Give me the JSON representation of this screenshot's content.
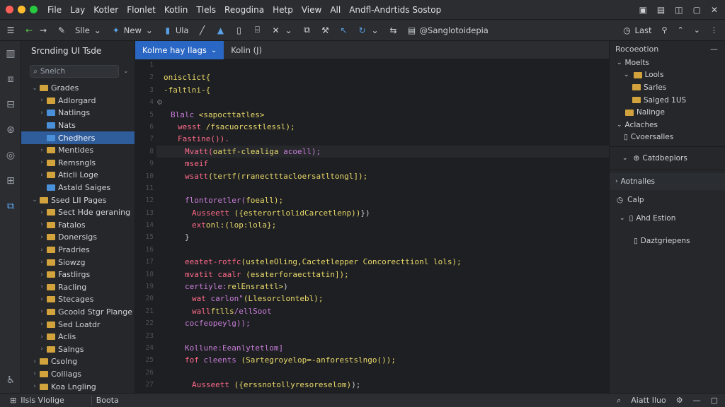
{
  "menubar": {
    "items": [
      "File",
      "Lay",
      "Kotler",
      "Flonlet",
      "Kotlin",
      "Tlels",
      "Reogdina",
      "Hetp",
      "View",
      "All",
      "Andfl-Andrtids Sostop"
    ],
    "window_dots": [
      "#ff5f57",
      "#febc2e",
      "#28c840"
    ]
  },
  "toolbar": {
    "items": [
      "Slle",
      "New",
      "Ula",
      "@Sanglotoidepia"
    ],
    "right_label": "Last"
  },
  "left_panel": {
    "title": "Srcnding UI Tsde",
    "search_value": "Snelch",
    "tree": [
      {
        "label": "Grades",
        "indent": 1,
        "chev": "v",
        "icon": "folder"
      },
      {
        "label": "Adlorgard",
        "indent": 2,
        "chev": ">",
        "icon": "folder"
      },
      {
        "label": "Natlings",
        "indent": 2,
        "chev": ">",
        "icon": "folder-blue"
      },
      {
        "label": "Nats",
        "indent": 2,
        "chev": "",
        "icon": "folder-blue"
      },
      {
        "label": "Chedhers",
        "indent": 2,
        "chev": "",
        "icon": "folder-blue",
        "selected": true
      },
      {
        "label": "Mentides",
        "indent": 2,
        "chev": ">",
        "icon": "folder"
      },
      {
        "label": "Remsngls",
        "indent": 2,
        "chev": ">",
        "icon": "folder"
      },
      {
        "label": "Aticli Loge",
        "indent": 2,
        "chev": ">",
        "icon": "folder"
      },
      {
        "label": "Astald Saiges",
        "indent": 2,
        "chev": "",
        "icon": "folder-blue"
      },
      {
        "label": "Ssed LII Pages",
        "indent": 1,
        "chev": "v",
        "icon": "folder"
      },
      {
        "label": "Sect Hde geraning",
        "indent": 2,
        "chev": ">",
        "icon": "folder"
      },
      {
        "label": "Fatalos",
        "indent": 2,
        "chev": ">",
        "icon": "folder"
      },
      {
        "label": "Donersigs",
        "indent": 2,
        "chev": ">",
        "icon": "folder"
      },
      {
        "label": "Pradries",
        "indent": 2,
        "chev": ">",
        "icon": "folder"
      },
      {
        "label": "Siowzg",
        "indent": 2,
        "chev": ">",
        "icon": "folder"
      },
      {
        "label": "Fastlirgs",
        "indent": 2,
        "chev": ">",
        "icon": "folder"
      },
      {
        "label": "Racling",
        "indent": 2,
        "chev": ">",
        "icon": "folder"
      },
      {
        "label": "Stecages",
        "indent": 2,
        "chev": ">",
        "icon": "folder"
      },
      {
        "label": "Gcoold Stgr Plange",
        "indent": 2,
        "chev": ">",
        "icon": "folder"
      },
      {
        "label": "Sed Loatdr",
        "indent": 2,
        "chev": ">",
        "icon": "folder"
      },
      {
        "label": "Aclis",
        "indent": 2,
        "chev": ">",
        "icon": "folder"
      },
      {
        "label": "Salngs",
        "indent": 2,
        "chev": ">",
        "icon": "folder"
      },
      {
        "label": "Csolng",
        "indent": 1,
        "chev": ">",
        "icon": "folder"
      },
      {
        "label": "Colliags",
        "indent": 1,
        "chev": ">",
        "icon": "folder"
      },
      {
        "label": "Koa Lngling",
        "indent": 1,
        "chev": ">",
        "icon": "folder"
      }
    ]
  },
  "editor_tabs": [
    {
      "label": "Kolme hay Ilags",
      "active": true
    },
    {
      "label": "Kolin (J)",
      "active": false
    }
  ],
  "editor": {
    "line_numbers": [
      "1",
      "2",
      "3",
      "4",
      "5",
      "6",
      "7",
      "8",
      "9",
      "10",
      "11",
      "12",
      "13",
      "14",
      "15",
      "16",
      "17",
      "18",
      "19",
      "20",
      "21",
      "22",
      "23",
      "24",
      "25",
      "26",
      "27"
    ],
    "lines": [
      {
        "indent": 0,
        "parts": [
          {
            "t": "",
            "c": "#c9ccd1"
          }
        ]
      },
      {
        "indent": 1,
        "parts": [
          {
            "t": "onisclict{",
            "c": "#e8d86a"
          }
        ]
      },
      {
        "indent": 1,
        "parts": [
          {
            "t": "-faltlni-{",
            "c": "#e8d86a"
          }
        ]
      },
      {
        "indent": 0,
        "parts": [
          {
            "t": "",
            "c": "#c9ccd1"
          }
        ]
      },
      {
        "indent": 2,
        "parts": [
          {
            "t": "Blalc ",
            "c": "#c77dd9"
          },
          {
            "t": "<sapocttatles>",
            "c": "#e8d86a"
          }
        ]
      },
      {
        "indent": 3,
        "parts": [
          {
            "t": "wesst ",
            "c": "#ff6b8b"
          },
          {
            "t": "/fsacuorcsstlessl);",
            "c": "#e8d86a"
          }
        ]
      },
      {
        "indent": 3,
        "parts": [
          {
            "t": "Fastine()).",
            "c": "#ff6b8b"
          }
        ]
      },
      {
        "indent": 4,
        "hl": true,
        "parts": [
          {
            "t": "Mvatt(",
            "c": "#ff6b8b"
          },
          {
            "t": "oattf-clealiga ",
            "c": "#e8d86a"
          },
          {
            "t": "acoell);",
            "c": "#c77dd9"
          }
        ]
      },
      {
        "indent": 4,
        "parts": [
          {
            "t": "mseif",
            "c": "#ff6b8b"
          }
        ]
      },
      {
        "indent": 4,
        "parts": [
          {
            "t": "wsatt",
            "c": "#ff6b8b"
          },
          {
            "t": "(tertf(rranectttacloersatltongl]);",
            "c": "#e8d86a"
          }
        ]
      },
      {
        "indent": 0,
        "parts": [
          {
            "t": "",
            "c": "#c9ccd1"
          }
        ]
      },
      {
        "indent": 4,
        "parts": [
          {
            "t": "flontoretler(",
            "c": "#c77dd9"
          },
          {
            "t": "foeall);",
            "c": "#e8d86a"
          }
        ]
      },
      {
        "indent": 5,
        "parts": [
          {
            "t": "Ausseett ",
            "c": "#ff6b8b"
          },
          {
            "t": "({esterortlolidCarcetlenp))",
            "c": "#e8d86a"
          },
          {
            "t": "})",
            "c": "#c9ccd1"
          }
        ]
      },
      {
        "indent": 5,
        "parts": [
          {
            "t": "ext",
            "c": "#ff6b8b"
          },
          {
            "t": "onl:(lop:lola};",
            "c": "#e8d86a"
          }
        ]
      },
      {
        "indent": 4,
        "parts": [
          {
            "t": "}",
            "c": "#c9ccd1"
          }
        ]
      },
      {
        "indent": 0,
        "parts": [
          {
            "t": "",
            "c": "#c9ccd1"
          }
        ]
      },
      {
        "indent": 4,
        "parts": [
          {
            "t": "eeatet-rotfc",
            "c": "#ff6b8b"
          },
          {
            "t": "(usteleOling,Cactetlepper Concorecttionl lols);",
            "c": "#e8d86a"
          }
        ]
      },
      {
        "indent": 4,
        "parts": [
          {
            "t": "mvatit caalr ",
            "c": "#ff6b8b"
          },
          {
            "t": "(esaterforaecttatin]);",
            "c": "#e8d86a"
          }
        ]
      },
      {
        "indent": 4,
        "parts": [
          {
            "t": "certiyle:",
            "c": "#c77dd9"
          },
          {
            "t": "relEnsrattl>",
            "c": "#e8d86a"
          },
          {
            "t": ")",
            "c": "#c9ccd1"
          }
        ]
      },
      {
        "indent": 5,
        "parts": [
          {
            "t": "wat ",
            "c": "#ff6b8b"
          },
          {
            "t": "carlon\"",
            "c": "#c77dd9"
          },
          {
            "t": "(Llesorclontebl);",
            "c": "#e8d86a"
          }
        ]
      },
      {
        "indent": 5,
        "parts": [
          {
            "t": "wall",
            "c": "#ff6b8b"
          },
          {
            "t": "ftlls",
            "c": "#e8d86a"
          },
          {
            "t": "/ellSoot",
            "c": "#c77dd9"
          }
        ]
      },
      {
        "indent": 4,
        "parts": [
          {
            "t": "cocfeopeylg));",
            "c": "#c77dd9"
          }
        ]
      },
      {
        "indent": 0,
        "parts": [
          {
            "t": "",
            "c": "#c9ccd1"
          }
        ]
      },
      {
        "indent": 4,
        "parts": [
          {
            "t": "Kollune:Eeanlytetlom]",
            "c": "#c77dd9"
          }
        ]
      },
      {
        "indent": 4,
        "parts": [
          {
            "t": "fof ",
            "c": "#ff6b8b"
          },
          {
            "t": "cleents ",
            "c": "#c77dd9"
          },
          {
            "t": "(Sartegroyelop=-anforestslngo());",
            "c": "#e8d86a"
          }
        ]
      },
      {
        "indent": 0,
        "parts": [
          {
            "t": "",
            "c": "#c9ccd1"
          }
        ]
      },
      {
        "indent": 5,
        "parts": [
          {
            "t": "Ausseett ",
            "c": "#ff6b8b"
          },
          {
            "t": "({erssnotollyresoreselom)",
            "c": "#e8d86a"
          },
          {
            "t": ");",
            "c": "#c9ccd1"
          }
        ]
      }
    ]
  },
  "right_panel": {
    "title": "Rocoeotion",
    "items": [
      {
        "label": "Moelts",
        "indent": 1,
        "chev": "v"
      },
      {
        "label": "Lools",
        "indent": 2,
        "chev": "v",
        "folder": true
      },
      {
        "label": "Sarles",
        "indent": 3,
        "folder": true
      },
      {
        "label": "Salged 1US",
        "indent": 3,
        "folder": true
      },
      {
        "label": "Nalinge",
        "indent": 2,
        "folder": true
      },
      {
        "label": "Aclaches",
        "indent": 1,
        "chev": "v"
      },
      {
        "label": "Cvoersalles",
        "indent": 2,
        "icon": "doc"
      }
    ],
    "lower_items": [
      {
        "label": "Catdbeplors"
      },
      {
        "label": "Aotnalles"
      },
      {
        "label": "Calp"
      },
      {
        "label": "Ahd Estion"
      },
      {
        "label": "Daztgriepens"
      }
    ]
  },
  "statusbar": {
    "left": "Ilsis Vlolige",
    "mid": "Boota",
    "right": "Aiatt Iluo"
  }
}
